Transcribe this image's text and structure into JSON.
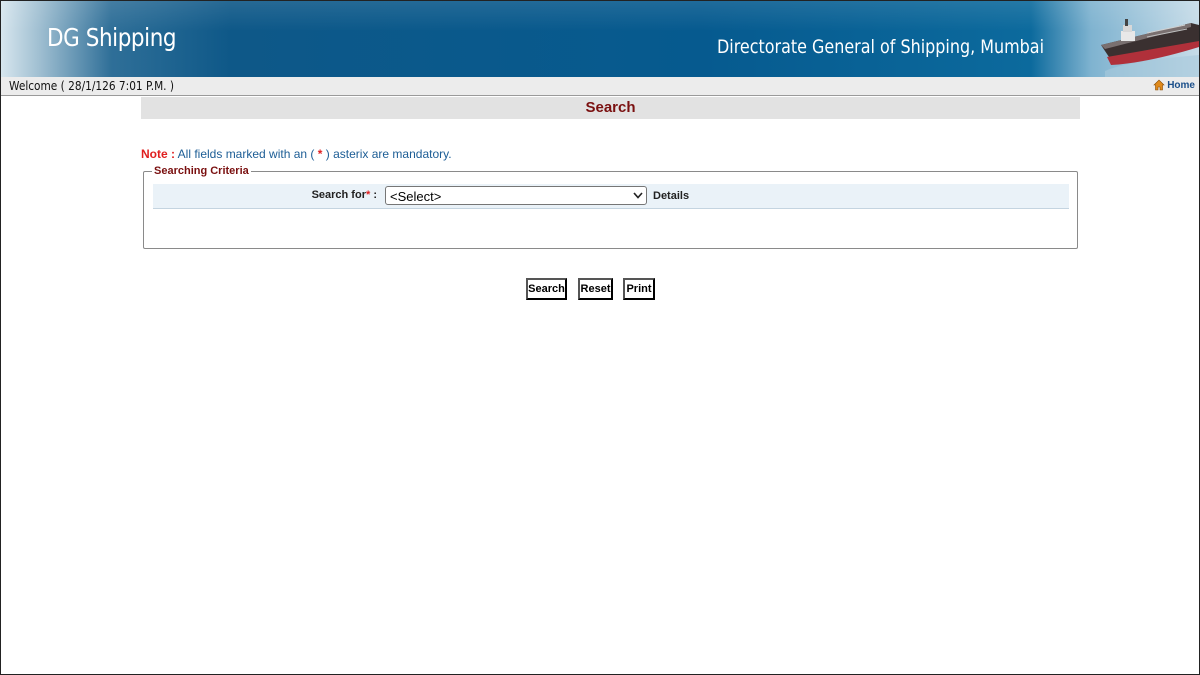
{
  "header": {
    "brand": "DG Shipping",
    "organization": "Directorate General of Shipping, Mumbai"
  },
  "welcome_bar": {
    "text": "Welcome ( 28/1/126 7:01 P.M. )",
    "home_label": "Home"
  },
  "page": {
    "title": "Search"
  },
  "note": {
    "key": "Note :",
    "text_before": " All fields marked with an ( ",
    "star": "*",
    "text_after": " ) asterix are mandatory."
  },
  "criteria": {
    "legend": "Searching Criteria",
    "search_for_label": "Search for",
    "required_marker": "*",
    "label_suffix": " :",
    "select_value": "<Select>",
    "details_label": "Details"
  },
  "buttons": {
    "search": "Search",
    "reset": "Reset",
    "print": "Print"
  },
  "colors": {
    "banner": "#065a8f",
    "title": "#7a1010",
    "note_text": "#1c5d95",
    "required": "#e02020"
  },
  "icons": {
    "home": "home-icon",
    "ship": "ship-image",
    "dropdown": "chevron-down-icon"
  }
}
